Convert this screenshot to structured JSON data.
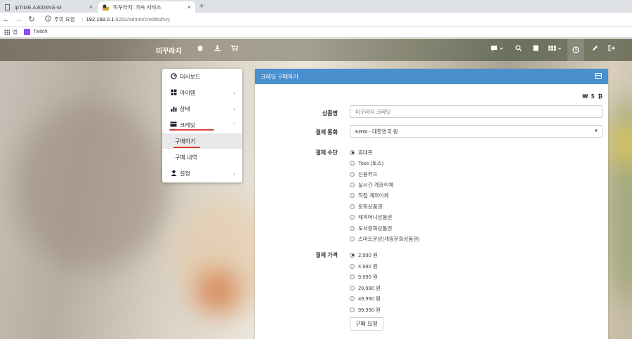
{
  "browser": {
    "tabs": [
      {
        "title": "ipTIME A3004NS-M"
      },
      {
        "title": "미꾸라지: 가속 서비스"
      }
    ],
    "url": {
      "security_label": "주의 요함",
      "host": "192.168.0.1",
      "path": ":8282/admin/credits/buy"
    },
    "bookmarks": [
      {
        "label": "앱"
      },
      {
        "label": "Twitch"
      }
    ]
  },
  "topnav": {
    "brand": "미꾸라지"
  },
  "sidebar": {
    "items": [
      {
        "label": "대시보드",
        "icon": "dashboard-icon"
      },
      {
        "label": "아이템",
        "icon": "grid-icon"
      },
      {
        "label": "상태",
        "icon": "bar-chart-icon"
      },
      {
        "label": "크레딧",
        "icon": "credit-card-icon"
      },
      {
        "label": "설정",
        "icon": "user-icon"
      }
    ],
    "sub_items": [
      {
        "label": "구매하기"
      },
      {
        "label": "구매 내역"
      }
    ]
  },
  "panel": {
    "title": "크레딧 구매하기",
    "fields": {
      "product_label": "상품명",
      "product_value": "미꾸라지 크레딧",
      "currency_label": "결제 통화",
      "currency_value": "KRW - 대한민국 원",
      "method_label": "결제 수단",
      "price_label": "결제 가격"
    },
    "methods": [
      {
        "label": "휴대폰",
        "checked": true
      },
      {
        "label": "Toss (토스)",
        "checked": false
      },
      {
        "label": "신용카드",
        "checked": false
      },
      {
        "label": "실시간 계좌이체",
        "checked": false
      },
      {
        "label": "직접 계좌이체",
        "checked": false
      },
      {
        "label": "문화상품권",
        "checked": false
      },
      {
        "label": "해피머니상품권",
        "checked": false
      },
      {
        "label": "도서문화상품권",
        "checked": false
      },
      {
        "label": "스마트문상(게임문화상품권)",
        "checked": false
      }
    ],
    "prices": [
      {
        "label": "2,990 원",
        "checked": true
      },
      {
        "label": "4,990 원",
        "checked": false
      },
      {
        "label": "9,990 원",
        "checked": false
      },
      {
        "label": "29,990 원",
        "checked": false
      },
      {
        "label": "49,990 원",
        "checked": false
      },
      {
        "label": "99,990 원",
        "checked": false
      }
    ],
    "submit_label": "구매 요청",
    "pay_icons": [
      {
        "glyph": "₩"
      },
      {
        "glyph": "$"
      },
      {
        "glyph": "₿"
      }
    ]
  },
  "colors": {
    "panel_header": "#4a8fce",
    "underline": "#e03c31"
  }
}
